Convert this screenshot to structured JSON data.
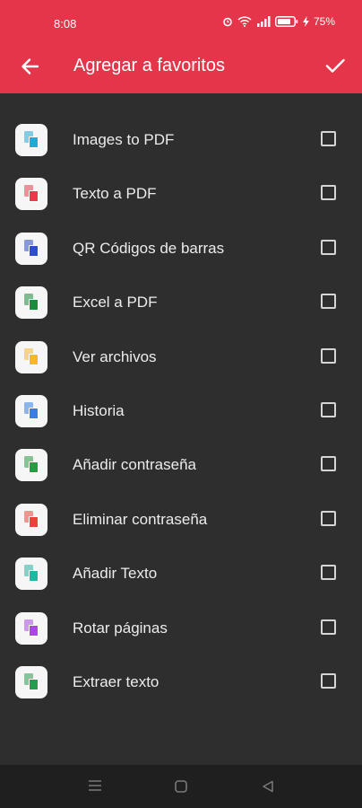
{
  "status_bar": {
    "time": "8:08",
    "battery": "75%"
  },
  "toolbar": {
    "title": "Agregar a favoritos",
    "back_icon": "arrow-back-icon",
    "confirm_icon": "check-icon"
  },
  "colors": {
    "header": "#e4354a",
    "background": "#2e2e2e",
    "navbar": "#1f1f1f"
  },
  "items": [
    {
      "label": "Images to PDF",
      "icon": "images-to-pdf-icon",
      "color": "#27a9d6",
      "checked": false
    },
    {
      "label": "Texto a PDF",
      "icon": "text-to-pdf-icon",
      "color": "#e93a4d",
      "checked": false
    },
    {
      "label": "QR Códigos de barras",
      "icon": "qr-barcode-icon",
      "color": "#2f4fc7",
      "checked": false
    },
    {
      "label": "Excel a PDF",
      "icon": "excel-to-pdf-icon",
      "color": "#1e8a3c",
      "checked": false
    },
    {
      "label": "Ver archivos",
      "icon": "view-files-icon",
      "color": "#f5b82a",
      "checked": false
    },
    {
      "label": "Historia",
      "icon": "history-icon",
      "color": "#3b7de0",
      "checked": false
    },
    {
      "label": "Añadir contraseña",
      "icon": "add-password-icon",
      "color": "#2a9a45",
      "checked": false
    },
    {
      "label": "Eliminar contraseña",
      "icon": "remove-password-icon",
      "color": "#e5453a",
      "checked": false
    },
    {
      "label": "Añadir Texto",
      "icon": "add-text-icon",
      "color": "#1fb8a0",
      "checked": false
    },
    {
      "label": "Rotar páginas",
      "icon": "rotate-pages-icon",
      "color": "#a84ae0",
      "checked": false
    },
    {
      "label": "Extraer texto",
      "icon": "extract-text-icon",
      "color": "#2a9a50",
      "checked": false
    }
  ],
  "nav": {
    "menu_icon": "recents-icon",
    "home_icon": "home-icon",
    "back_icon": "nav-back-icon"
  }
}
